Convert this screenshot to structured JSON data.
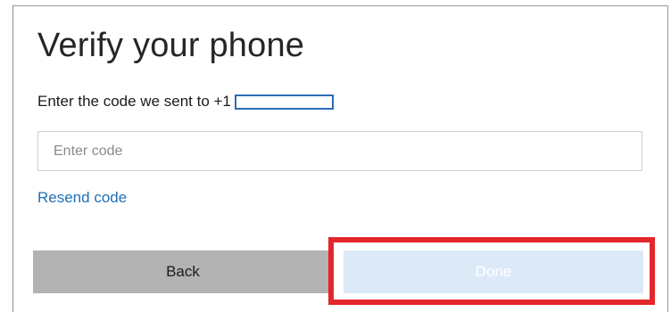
{
  "dialog": {
    "title": "Verify your phone",
    "instruction": "Enter the code we sent to +1",
    "code_field": {
      "placeholder": "Enter code",
      "value": ""
    },
    "resend_label": "Resend code",
    "back_label": "Back",
    "done_label": "Done"
  },
  "colors": {
    "link": "#1f6fb8",
    "highlight": "#e3262b",
    "done_button_bg": "#dceaf8",
    "back_button_bg": "#b3b3b3"
  }
}
